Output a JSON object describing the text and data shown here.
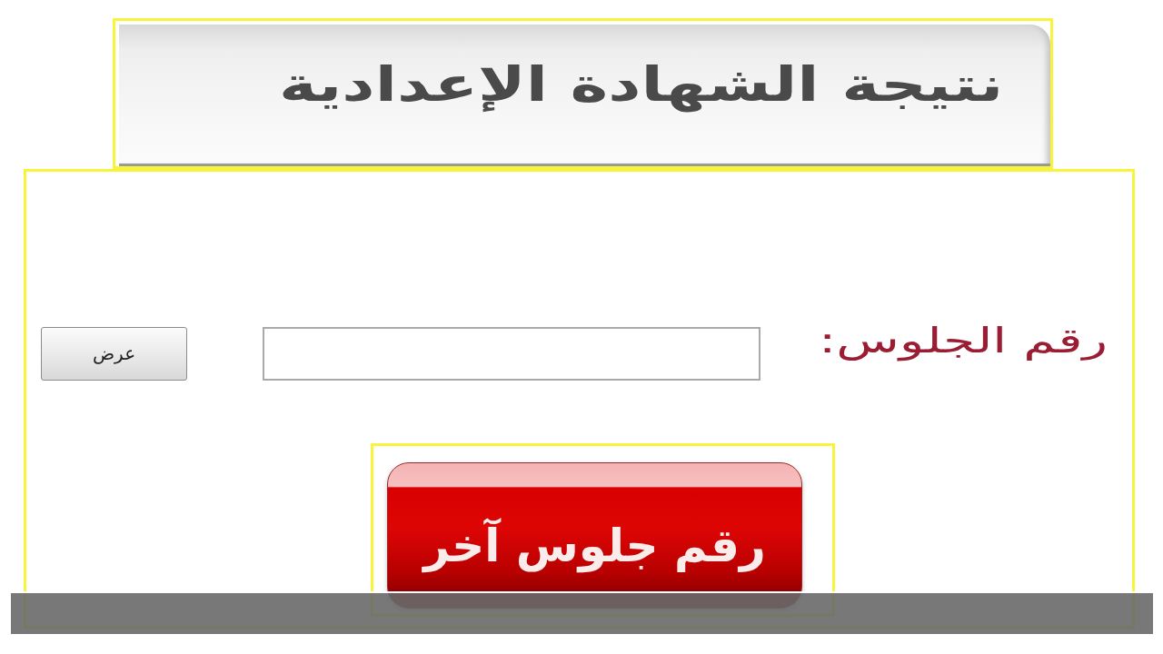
{
  "header": {
    "title": "نتيجة الشهادة الإعدادية"
  },
  "form": {
    "label": "رقم الجلوس:",
    "submit_button": "عرض"
  },
  "another_button": "رقم جلوس آخر"
}
